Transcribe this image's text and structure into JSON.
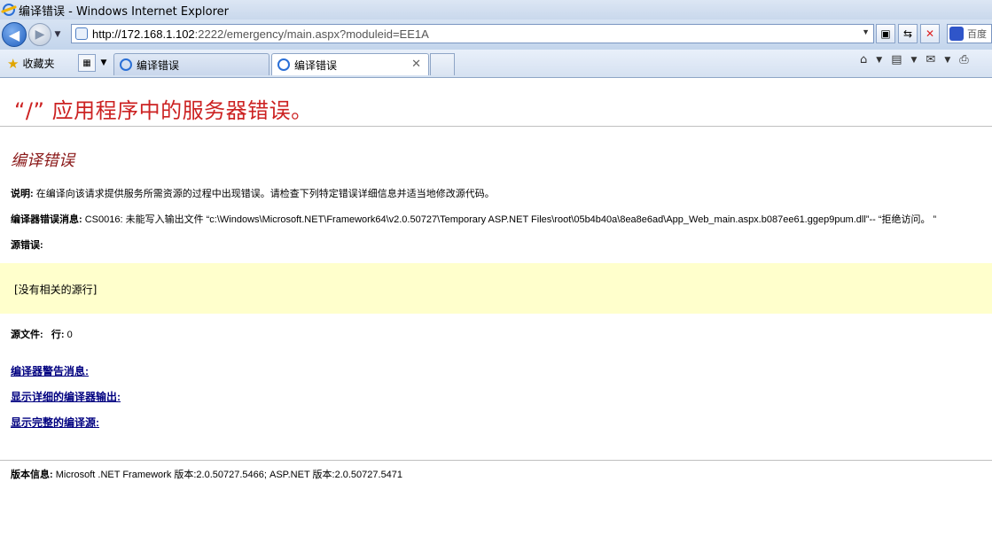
{
  "window": {
    "title": "编译错误 - Windows Internet Explorer"
  },
  "address": {
    "url_host": "http://172.168.1.102",
    "url_path": ":2222/emergency/main.aspx?moduleid=EE1A"
  },
  "search": {
    "label": "百度"
  },
  "toolbar": {
    "favorites_label": "收藏夹"
  },
  "tabs": [
    {
      "label": "编译错误"
    },
    {
      "label": "编译错误"
    }
  ],
  "page": {
    "heading": "“/” 应用程序中的服务器错误。",
    "subheading": "编译错误",
    "description_label": "说明:",
    "description_text": " 在编译向该请求提供服务所需资源的过程中出现错误。请检查下列特定错误详细信息并适当地修改源代码。",
    "compiler_error_label": "编译器错误消息:",
    "compiler_error_text": " CS0016: 未能写入输出文件 “c:\\Windows\\Microsoft.NET\\Framework64\\v2.0.50727\\Temporary ASP.NET Files\\root\\05b4b40a\\8ea8e6ad\\App_Web_main.aspx.b087ee61.ggep9pum.dll”-- “拒绝访问。 ”",
    "source_error_label": "源错误:",
    "source_box_text": "[没有相关的源行]",
    "source_file_label": "源文件:",
    "line_label": "行:",
    "line_value": "0",
    "link_warnings": "编译器警告消息:",
    "link_detailed": "显示详细的编译器输出:",
    "link_full_source": "显示完整的编译源:",
    "version_label": "版本信息:",
    "version_text": " Microsoft .NET Framework 版本:2.0.50727.5466; ASP.NET 版本:2.0.50727.5471"
  }
}
